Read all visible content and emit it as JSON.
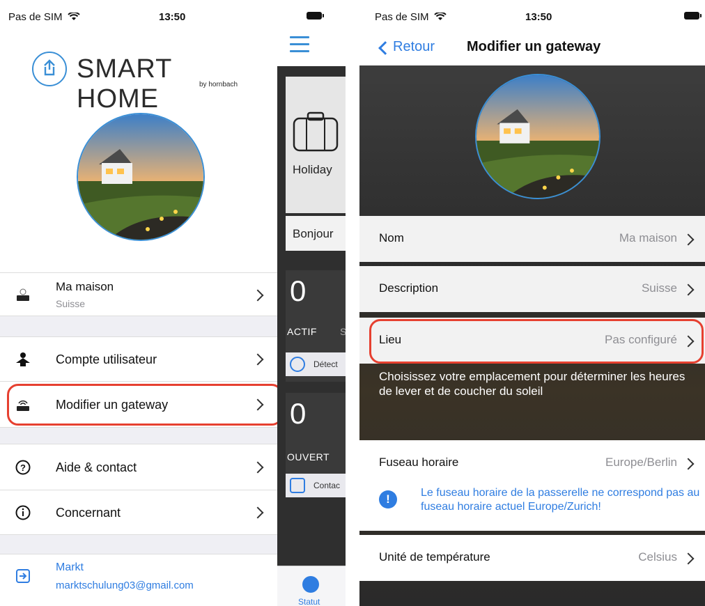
{
  "status": {
    "carrier": "Pas de SIM",
    "time": "13:50"
  },
  "menu": {
    "brand": "SMART HOME",
    "brand_sub": "by hornbach",
    "gateway": {
      "name": "Ma maison",
      "location": "Suisse"
    },
    "items": [
      {
        "label": "Compte utilisateur",
        "icon": "user-icon"
      },
      {
        "label": "Modifier un gateway",
        "icon": "gateway-icon"
      },
      {
        "label": "Aide & contact",
        "icon": "help-icon"
      },
      {
        "label": "Concernant",
        "icon": "info-icon"
      }
    ],
    "account": {
      "name": "Markt",
      "email": "marktschulung03@gmail.com"
    }
  },
  "dashboard": {
    "holiday": "Holiday",
    "greeting": "Bonjour",
    "active_count": "0",
    "active_label": "ACTIF",
    "active_label_cut": "S",
    "detect_label": "Détect",
    "open_count": "0",
    "open_label": "OUVERT",
    "contact_label": "Contac",
    "tab": "Statut"
  },
  "gateway_screen": {
    "back": "Retour",
    "title": "Modifier un gateway",
    "rows": [
      {
        "key": "Nom",
        "value": "Ma maison"
      },
      {
        "key": "Description",
        "value": "Suisse"
      },
      {
        "key": "Lieu",
        "value": "Pas configuré"
      }
    ],
    "location_hint": "Choisissez votre emplacement pour déterminer les heures de lever et de coucher du soleil",
    "timezone": {
      "key": "Fuseau horaire",
      "value": "Europe/Berlin"
    },
    "timezone_warning": "Le fuseau horaire de la passerelle ne correspond pas au fuseau horaire actuel Europe/Zurich!",
    "temperature": {
      "key": "Unité de température",
      "value": "Celsius"
    }
  },
  "colors": {
    "accent": "#2f7de1",
    "highlight": "#e64030"
  }
}
